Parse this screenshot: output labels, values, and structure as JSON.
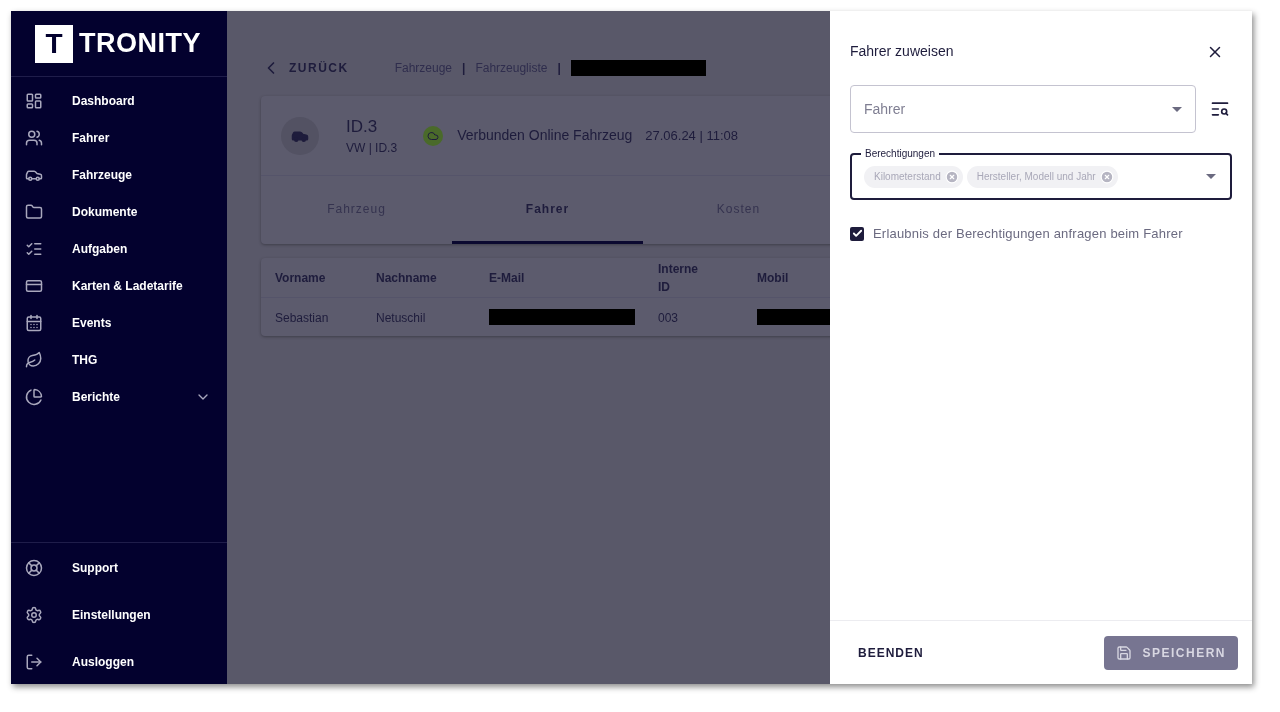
{
  "sidebar": {
    "logo": {
      "mark": "T",
      "text": "TRONITY"
    },
    "items": [
      {
        "label": "Dashboard"
      },
      {
        "label": "Fahrer"
      },
      {
        "label": "Fahrzeuge"
      },
      {
        "label": "Dokumente"
      },
      {
        "label": "Aufgaben"
      },
      {
        "label": "Karten & Ladetarife"
      },
      {
        "label": "Events"
      },
      {
        "label": "THG"
      },
      {
        "label": "Berichte",
        "expanded": false
      }
    ],
    "footer_items": [
      {
        "label": "Support"
      },
      {
        "label": "Einstellungen"
      },
      {
        "label": "Ausloggen"
      }
    ]
  },
  "back_link": "ZURÜCK",
  "breadcrumb": [
    {
      "kind": "link",
      "text": "Fahrzeuge"
    },
    {
      "kind": "separator",
      "text": "|"
    },
    {
      "kind": "link",
      "text": "Fahrzeugliste"
    },
    {
      "kind": "separator",
      "text": "|"
    },
    {
      "kind": "redacted"
    }
  ],
  "vehicle": {
    "name": "ID.3",
    "subtitle": "VW | ID.3",
    "status": "Verbunden Online Fahrzeug",
    "timestamp": "27.06.24 | 11:08"
  },
  "tabs": [
    {
      "label": "Fahrzeug",
      "selected": false
    },
    {
      "label": "Fahrer",
      "selected": true
    },
    {
      "label": "Kosten",
      "selected": false
    }
  ],
  "table": {
    "columns": [
      "Vorname",
      "Nachname",
      "E-Mail",
      "Interne ID",
      "Mobil"
    ],
    "rows": [
      [
        {
          "kind": "text",
          "text": "Sebastian"
        },
        {
          "kind": "text",
          "text": "Netuschil"
        },
        {
          "kind": "redacted"
        },
        {
          "kind": "text",
          "text": "003"
        },
        {
          "kind": "redacted"
        }
      ]
    ]
  },
  "drawer": {
    "title": "Fahrer zuweisen",
    "driver_select": {
      "placeholder": "Fahrer"
    },
    "permissions": {
      "label": "Berechtigungen",
      "chips": [
        "Kilometerstand",
        "Hersteller, Modell und Jahr"
      ]
    },
    "request_checkbox": {
      "label": "Erlaubnis der Berechtigungen anfragen beim Fahrer",
      "checked": true
    },
    "cancel_button": "BEENDEN",
    "save_button": {
      "label": "SPEICHERN",
      "disabled": true
    }
  }
}
